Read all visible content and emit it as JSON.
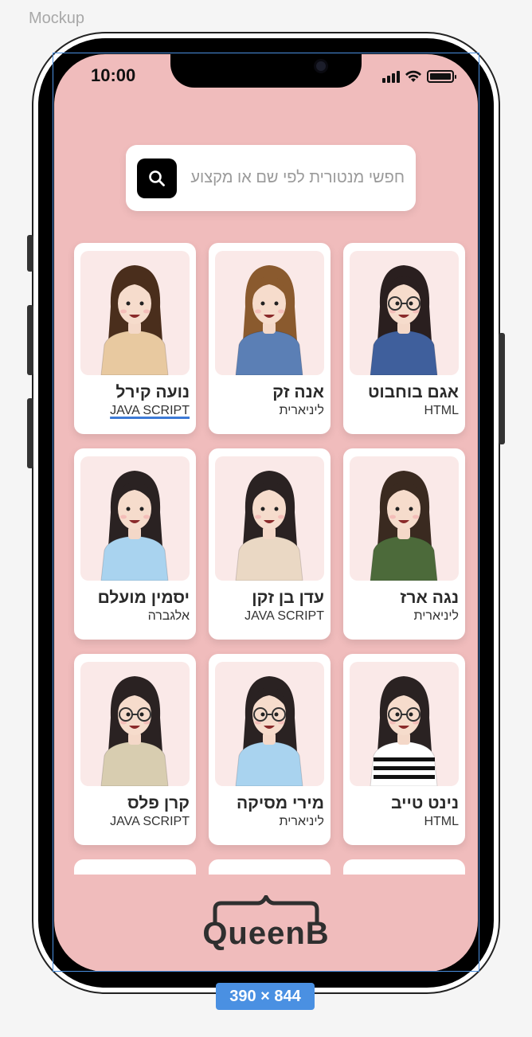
{
  "canvas": {
    "label": "Mockup",
    "dimensions": "390 × 844"
  },
  "status": {
    "time": "10:00"
  },
  "search": {
    "placeholder": "חפשי מנטורית לפי שם או מקצוע",
    "icon": "search-icon"
  },
  "mentors": [
    {
      "name": "אגם בוחבוט",
      "subject": "HTML",
      "hair": "#2a1f1f",
      "top": "#3f5f9c",
      "topName": "denim-jacket",
      "glasses": true,
      "underline": false
    },
    {
      "name": "אנה זק",
      "subject": "ליניארית",
      "hair": "#8a5a2e",
      "top": "#5b7fb5",
      "topName": "denim-jacket",
      "glasses": false,
      "underline": false
    },
    {
      "name": "נועה קירל",
      "subject": "JAVA SCRIPT",
      "hair": "#4a2e1c",
      "top": "#e8c9a0",
      "topName": "hoodie",
      "glasses": false,
      "underline": true
    },
    {
      "name": "נגה ארז",
      "subject": "ליניארית",
      "hair": "#3a2a20",
      "top": "#4c6a3a",
      "topName": "green-jacket",
      "glasses": false,
      "underline": false
    },
    {
      "name": "עדן בן זקן",
      "subject": "JAVA SCRIPT",
      "hair": "#2a2222",
      "top": "#ead8c4",
      "topName": "beige-jacket",
      "glasses": false,
      "underline": false
    },
    {
      "name": "יסמין מועלם",
      "subject": "אלגברה",
      "hair": "#2a2222",
      "top": "#a9d3ef",
      "topName": "light-blue-sweater",
      "glasses": false,
      "underline": false
    },
    {
      "name": "נינט טייב",
      "subject": "HTML",
      "hair": "#2a2222",
      "top": "#ffffff",
      "topName": "striped-shirt",
      "glasses": true,
      "underline": false
    },
    {
      "name": "מירי מסיקה",
      "subject": "ליניארית",
      "hair": "#2a2222",
      "top": "#a9d3ef",
      "topName": "blue-jacket",
      "glasses": true,
      "underline": false
    },
    {
      "name": "קרן פלס",
      "subject": "JAVA SCRIPT",
      "hair": "#2a2222",
      "top": "#d8cdb0",
      "topName": "khaki-jacket",
      "glasses": true,
      "underline": false
    }
  ],
  "footer": {
    "logo": "QueenB"
  },
  "colors": {
    "background": "#f0bcbc",
    "card": "#ffffff",
    "avatar_bg": "#fae9e8",
    "accent": "#4a90e2"
  }
}
